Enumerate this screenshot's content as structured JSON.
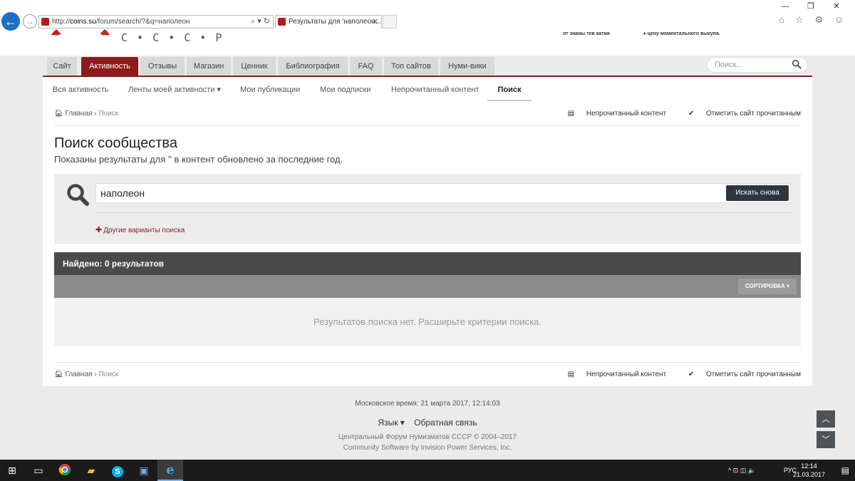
{
  "browser": {
    "url_prefix": "http://",
    "url_host": "coins.su",
    "url_path": "/forum/search/?&q=наполеон",
    "address_tools": "⌕ ▾ ↻",
    "tab_title": "Результаты для 'наполеон...",
    "tab_close": "✕",
    "window_controls": [
      "—",
      "❐",
      "✕"
    ],
    "toolbar_icons": "⌂ ☆ ⚙ ☺"
  },
  "site_header": {
    "logo_text": "С • С • С • Р",
    "note1": "от знаны тев катия",
    "note2": "♦ цену моментального выкупа."
  },
  "navbar": {
    "tabs": [
      {
        "label": "Сайт",
        "active": false
      },
      {
        "label": "Активность",
        "active": true
      },
      {
        "label": "Отзывы",
        "active": false
      },
      {
        "label": "Магазин",
        "active": false
      },
      {
        "label": "Ценник",
        "active": false
      },
      {
        "label": "Библиография",
        "active": false
      },
      {
        "label": "FAQ",
        "active": false
      },
      {
        "label": "Топ сайтов",
        "active": false
      },
      {
        "label": "Нуми-вики",
        "active": false
      }
    ],
    "search_placeholder": "Поиск..."
  },
  "subnav": {
    "items": [
      {
        "label": "Вся активность",
        "active": false
      },
      {
        "label": "Ленты моей активности ▾",
        "active": false
      },
      {
        "label": "Мои публикации",
        "active": false
      },
      {
        "label": "Мои подписки",
        "active": false
      },
      {
        "label": "Непрочитанный контент",
        "active": false
      },
      {
        "label": "Поиск",
        "active": true
      }
    ]
  },
  "breadcrumb": {
    "home": "Главная",
    "separator": "›",
    "current": "Поиск",
    "unread_link": "Непрочитанный контент",
    "mark_read_link": "Отметить сайт прочитанным"
  },
  "page": {
    "title": "Поиск сообщества",
    "subtitle": "Показаны результаты для '' в контент обновлено за последние год."
  },
  "search": {
    "query": "наполеон",
    "search_again": "Искать снова",
    "other_options": "Другие варианты поиска"
  },
  "results": {
    "found": "Найдено: 0 результатов",
    "sort_button": "СОРТИРОВКА ▾",
    "empty_message": "Результатов поиска нет. Расширьте критерии поиска."
  },
  "footer": {
    "moscow_time": "Московское время: 21 марта 2017, 12:14:03",
    "language": "Язык ▾",
    "feedback": "Обратная связь",
    "copyright": "Центральный Форум Нумизматов СССР © 2004–2017",
    "software": "Community Software by Invision Power Services, Inc."
  },
  "scroll": {
    "up": "︿",
    "down": "﹀"
  },
  "taskbar": {
    "language": "РУС",
    "time": "12:14",
    "date": "21.03.2017",
    "tray_icons": "^ ⊡ ◫ 🔈"
  },
  "colors": {
    "accent": "#8c1b1b",
    "dark_header": "#4a4a4a",
    "button_dark": "#2e3640"
  }
}
